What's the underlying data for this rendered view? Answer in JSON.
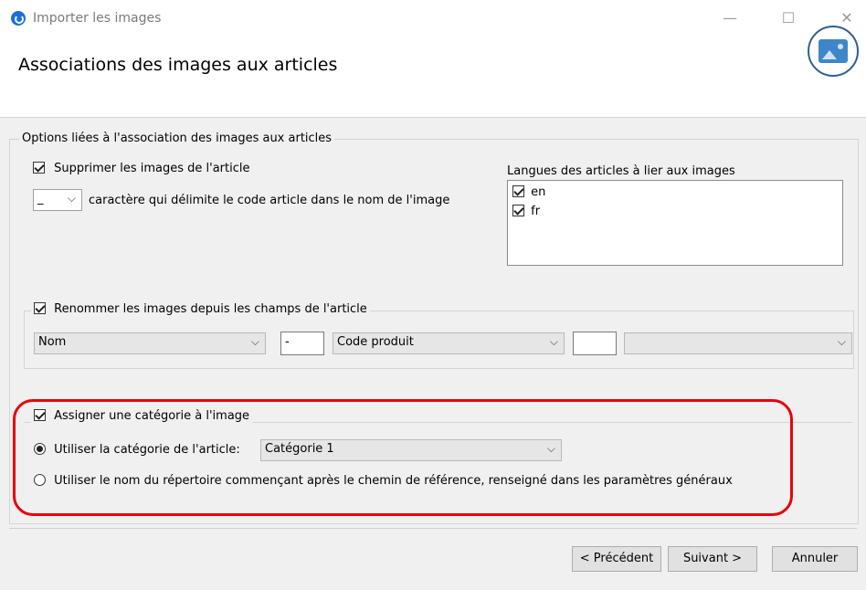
{
  "window": {
    "title": "Importer les images",
    "minimize_glyph": "—",
    "maximize_glyph": "☐",
    "close_glyph": "✕"
  },
  "header": {
    "title": "Associations des images aux articles",
    "logo_icon": "image-icon"
  },
  "options_group": {
    "legend": "Options liées à l'association des images aux articles",
    "delete_images": {
      "label": "Supprimer les images de l'article",
      "checked": true
    },
    "delimiter": {
      "value": "_",
      "label": "caractère qui délimite le code article dans le nom de l'image"
    },
    "languages": {
      "label": "Langues des articles à lier aux images",
      "items": [
        {
          "label": "en",
          "checked": true
        },
        {
          "label": "fr",
          "checked": true
        }
      ]
    }
  },
  "rename_group": {
    "legend": "Renommer les images depuis les champs de l'article",
    "checked": true,
    "field1": "Nom",
    "separator1": "-",
    "field2": "Code produit",
    "separator2": "",
    "field3": ""
  },
  "category_group": {
    "legend": "Assigner une catégorie à l'image",
    "checked": true,
    "option_article": {
      "label": "Utiliser la catégorie de l'article:",
      "selected": true,
      "value": "Catégorie 1"
    },
    "option_directory": {
      "label": "Utiliser le nom du répertoire commençant après le chemin de référence, renseigné dans les paramètres généraux",
      "selected": false
    }
  },
  "buttons": {
    "previous": "< Précédent",
    "next": "Suivant >",
    "cancel": "Annuler"
  },
  "colors": {
    "highlight": "#e8000b",
    "accent": "#1e6fd9"
  }
}
